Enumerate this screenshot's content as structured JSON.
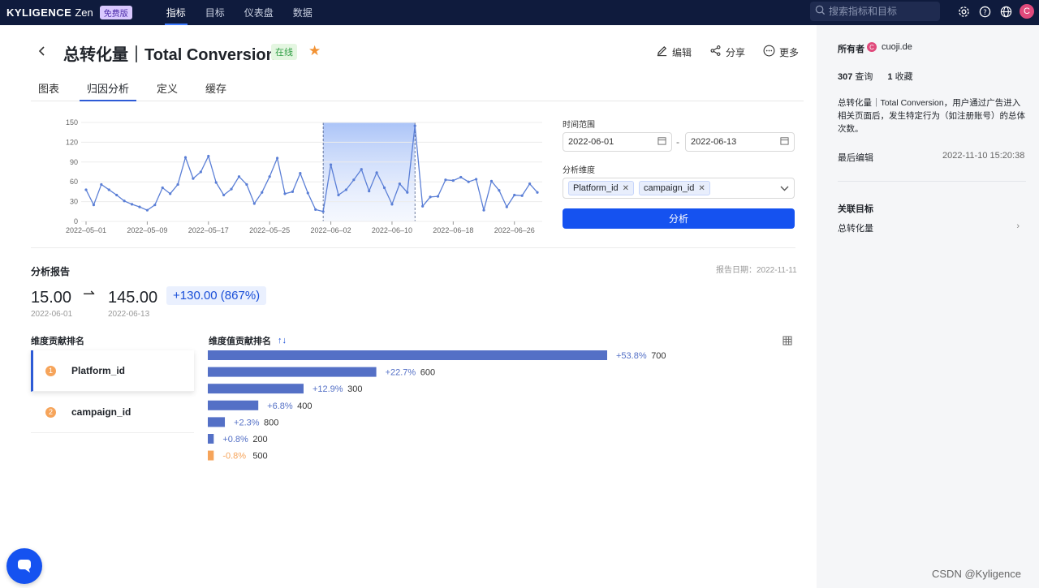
{
  "topbar": {
    "logo_main": "KYLIGENCE",
    "logo_zen": "Zen",
    "logo_badge": "免费版",
    "nav": [
      "指标",
      "目标",
      "仪表盘",
      "数据"
    ],
    "search_placeholder": "搜索指标和目标",
    "avatar_letter": "C"
  },
  "header": {
    "title": "总转化量｜Total Conversion",
    "status": "在线",
    "actions": {
      "edit": "编辑",
      "share": "分享",
      "more": "更多"
    }
  },
  "tabs": [
    "图表",
    "归因分析",
    "定义",
    "缓存"
  ],
  "chart_data": {
    "type": "line",
    "ylim": [
      0,
      150
    ],
    "yticks": [
      "0",
      "30",
      "60",
      "90",
      "120",
      "150"
    ],
    "xticks": [
      "2022–05–01",
      "2022–05–09",
      "2022–05–17",
      "2022–05–25",
      "2022–06–02",
      "2022–06–10",
      "2022–06–18",
      "2022–06–26"
    ],
    "highlight_range": [
      "2022-06-01",
      "2022-06-13"
    ],
    "values": [
      48,
      25,
      56,
      48,
      40,
      31,
      26,
      22,
      17,
      25,
      51,
      42,
      56,
      97,
      65,
      75,
      99,
      59,
      40,
      49,
      68,
      56,
      27,
      44,
      68,
      96,
      42,
      45,
      73,
      43,
      18,
      15,
      86,
      40,
      48,
      63,
      79,
      46,
      74,
      51,
      26,
      57,
      44,
      145,
      23,
      37,
      38,
      63,
      62,
      67,
      60,
      64,
      17,
      61,
      47,
      22,
      40,
      39,
      57,
      44
    ]
  },
  "form": {
    "time_range_label": "时间范围",
    "start_date": "2022-06-01",
    "end_date": "2022-06-13",
    "separator": "-",
    "dims_label": "分析维度",
    "dims": [
      "Platform_id",
      "campaign_id"
    ],
    "analyze_button": "分析"
  },
  "report": {
    "title": "分析报告",
    "report_date": "报告日期：2022-11-11",
    "from_value": "15.00",
    "from_date": "2022-06-01",
    "to_value": "145.00",
    "to_date": "2022-06-13",
    "delta": "+130.00 (867%)",
    "dim_rank_title": "维度贡献排名",
    "val_rank_title": "维度值贡献排名",
    "dimensions": [
      {
        "rank": "1",
        "name": "Platform_id"
      },
      {
        "rank": "2",
        "name": "campaign_id"
      }
    ],
    "bars": [
      {
        "pct": "+53.8%",
        "label": "700",
        "value": 53.8,
        "color": "#5470c6"
      },
      {
        "pct": "+22.7%",
        "label": "600",
        "value": 22.7,
        "color": "#5470c6"
      },
      {
        "pct": "+12.9%",
        "label": "300",
        "value": 12.9,
        "color": "#5470c6"
      },
      {
        "pct": "+6.8%",
        "label": "400",
        "value": 6.8,
        "color": "#5470c6"
      },
      {
        "pct": "+2.3%",
        "label": "800",
        "value": 2.3,
        "color": "#5470c6"
      },
      {
        "pct": "+0.8%",
        "label": "200",
        "value": 0.8,
        "color": "#5470c6"
      },
      {
        "pct": "-0.8%",
        "label": "500",
        "value": 0.8,
        "color": "#f6a45a"
      }
    ]
  },
  "right_panel": {
    "owner_label": "所有者",
    "owner_avatar": "C",
    "owner_name": "cuoji.de",
    "queries_count": "307",
    "queries_label": "查询",
    "favorites_count": "1",
    "favorites_label": "收藏",
    "description": "总转化量｜Total Conversion，用户通过广告进入相关页面后，发生特定行为（如注册账号）的总体次数。",
    "last_edit_label": "最后编辑",
    "last_edit_time": "2022-11-10 15:20:38",
    "related_title": "关联目标",
    "related_item": "总转化量"
  },
  "watermark": "CSDN @Kyligence"
}
